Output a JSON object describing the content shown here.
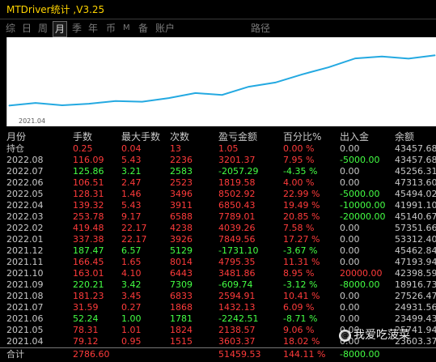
{
  "window": {
    "title": "MTDriver统计 ,V3.25"
  },
  "tabs": [
    {
      "label": "综",
      "active": false,
      "small": false
    },
    {
      "label": "日",
      "active": false,
      "small": false
    },
    {
      "label": "周",
      "active": false,
      "small": false
    },
    {
      "label": "月",
      "active": true,
      "small": false
    },
    {
      "label": "季",
      "active": false,
      "small": false
    },
    {
      "label": "年",
      "active": false,
      "small": false
    },
    {
      "label": "币",
      "active": false,
      "small": false
    },
    {
      "label": "M",
      "active": false,
      "small": true
    },
    {
      "label": "备",
      "active": false,
      "small": false
    },
    {
      "label": "账户",
      "active": false,
      "small": false
    },
    {
      "label": "路径",
      "active": false,
      "small": false
    }
  ],
  "chart": {
    "start_date": "2021.04"
  },
  "chart_data": {
    "type": "line",
    "x": [
      "2021.04",
      "2021.05",
      "2021.06",
      "2021.07",
      "2021.08",
      "2021.09",
      "2021.10",
      "2021.11",
      "2021.12",
      "2022.01",
      "2022.02",
      "2022.03",
      "2022.04",
      "2022.05",
      "2022.06",
      "2022.07",
      "2022.08"
    ],
    "y": [
      25589.07,
      28154.88,
      25911.96,
      27344.11,
      29939.12,
      29329.38,
      32811.07,
      37605.42,
      35874.32,
      43724.88,
      47764.14,
      55553.15,
      62403.58,
      70906.5,
      72726.08,
      70668.79,
      73870.16
    ],
    "color": "#24a9e1"
  },
  "colors": {
    "red": "#ff3b3b",
    "green": "#44ff44",
    "neutral": "#c8c8c8",
    "title": "#ffd400"
  },
  "table": {
    "headers": [
      "月份",
      "手数",
      "最大手数",
      "次数",
      "盈亏金额",
      "百分比%",
      "出入金",
      "余额"
    ],
    "rows": [
      {
        "month": "持仓",
        "lots": "0.25",
        "max_lots": "0.04",
        "count": "13",
        "pnl": "1.05",
        "pct": "0.00 %",
        "flow": "0.00",
        "balance": "43457.68",
        "tone": "red",
        "flow_tone": "neutral"
      },
      {
        "month": "2022.08",
        "lots": "116.09",
        "max_lots": "5.43",
        "count": "2236",
        "pnl": "3201.37",
        "pct": "7.95 %",
        "flow": "-5000.00",
        "balance": "43457.68",
        "tone": "red",
        "flow_tone": "green"
      },
      {
        "month": "2022.07",
        "lots": "125.86",
        "max_lots": "3.21",
        "count": "2583",
        "pnl": "-2057.29",
        "pct": "-4.35 %",
        "flow": "0.00",
        "balance": "45256.31",
        "tone": "green",
        "flow_tone": "neutral"
      },
      {
        "month": "2022.06",
        "lots": "106.51",
        "max_lots": "2.47",
        "count": "2523",
        "pnl": "1819.58",
        "pct": "4.00 %",
        "flow": "0.00",
        "balance": "47313.60",
        "tone": "red",
        "flow_tone": "neutral"
      },
      {
        "month": "2022.05",
        "lots": "128.31",
        "max_lots": "1.46",
        "count": "3496",
        "pnl": "8502.92",
        "pct": "22.99 %",
        "flow": "-5000.00",
        "balance": "45494.02",
        "tone": "red",
        "flow_tone": "green"
      },
      {
        "month": "2022.04",
        "lots": "139.32",
        "max_lots": "5.43",
        "count": "3911",
        "pnl": "6850.43",
        "pct": "19.49 %",
        "flow": "-10000.00",
        "balance": "41991.10",
        "tone": "red",
        "flow_tone": "green"
      },
      {
        "month": "2022.03",
        "lots": "253.78",
        "max_lots": "9.17",
        "count": "6588",
        "pnl": "7789.01",
        "pct": "20.85 %",
        "flow": "-20000.00",
        "balance": "45140.67",
        "tone": "red",
        "flow_tone": "green"
      },
      {
        "month": "2022.02",
        "lots": "419.48",
        "max_lots": "22.17",
        "count": "4238",
        "pnl": "4039.26",
        "pct": "7.58 %",
        "flow": "0.00",
        "balance": "57351.66",
        "tone": "red",
        "flow_tone": "neutral"
      },
      {
        "month": "2022.01",
        "lots": "337.38",
        "max_lots": "22.17",
        "count": "3926",
        "pnl": "7849.56",
        "pct": "17.27 %",
        "flow": "0.00",
        "balance": "53312.40",
        "tone": "red",
        "flow_tone": "neutral"
      },
      {
        "month": "2021.12",
        "lots": "187.47",
        "max_lots": "6.57",
        "count": "5129",
        "pnl": "-1731.10",
        "pct": "-3.67 %",
        "flow": "0.00",
        "balance": "45462.84",
        "tone": "green",
        "flow_tone": "neutral"
      },
      {
        "month": "2021.11",
        "lots": "166.45",
        "max_lots": "1.65",
        "count": "8014",
        "pnl": "4795.35",
        "pct": "11.31 %",
        "flow": "0.00",
        "balance": "47193.94",
        "tone": "red",
        "flow_tone": "neutral"
      },
      {
        "month": "2021.10",
        "lots": "163.01",
        "max_lots": "4.10",
        "count": "6443",
        "pnl": "3481.86",
        "pct": "8.95 %",
        "flow": "20000.00",
        "balance": "42398.59",
        "tone": "red",
        "flow_tone": "red"
      },
      {
        "month": "2021.09",
        "lots": "220.21",
        "max_lots": "3.42",
        "count": "7309",
        "pnl": "-609.74",
        "pct": "-3.12 %",
        "flow": "-8000.00",
        "balance": "18916.73",
        "tone": "green",
        "flow_tone": "green"
      },
      {
        "month": "2021.08",
        "lots": "181.23",
        "max_lots": "3.45",
        "count": "6833",
        "pnl": "2594.91",
        "pct": "10.41 %",
        "flow": "0.00",
        "balance": "27526.47",
        "tone": "red",
        "flow_tone": "neutral"
      },
      {
        "month": "2021.07",
        "lots": "31.59",
        "max_lots": "0.27",
        "count": "1868",
        "pnl": "1432.13",
        "pct": "6.09 %",
        "flow": "0.00",
        "balance": "24931.56",
        "tone": "red",
        "flow_tone": "neutral"
      },
      {
        "month": "2021.06",
        "lots": "52.24",
        "max_lots": "1.00",
        "count": "1781",
        "pnl": "-2242.51",
        "pct": "-8.71 %",
        "flow": "0.00",
        "balance": "23499.43",
        "tone": "green",
        "flow_tone": "neutral"
      },
      {
        "month": "2021.05",
        "lots": "78.31",
        "max_lots": "1.01",
        "count": "1824",
        "pnl": "2138.57",
        "pct": "9.06 %",
        "flow": "0.00",
        "balance": "25741.94",
        "tone": "red",
        "flow_tone": "neutral"
      },
      {
        "month": "2021.04",
        "lots": "79.12",
        "max_lots": "0.95",
        "count": "1515",
        "pnl": "3603.37",
        "pct": "18.02 %",
        "flow": "0.00",
        "balance": "23603.37",
        "tone": "red",
        "flow_tone": "neutral"
      }
    ],
    "total": {
      "label": "合计",
      "lots": "2786.60",
      "pnl": "51459.53",
      "pct": "144.11 %",
      "flow": "-8000.00"
    }
  },
  "watermark": {
    "text": "我爱吃菠菜"
  }
}
